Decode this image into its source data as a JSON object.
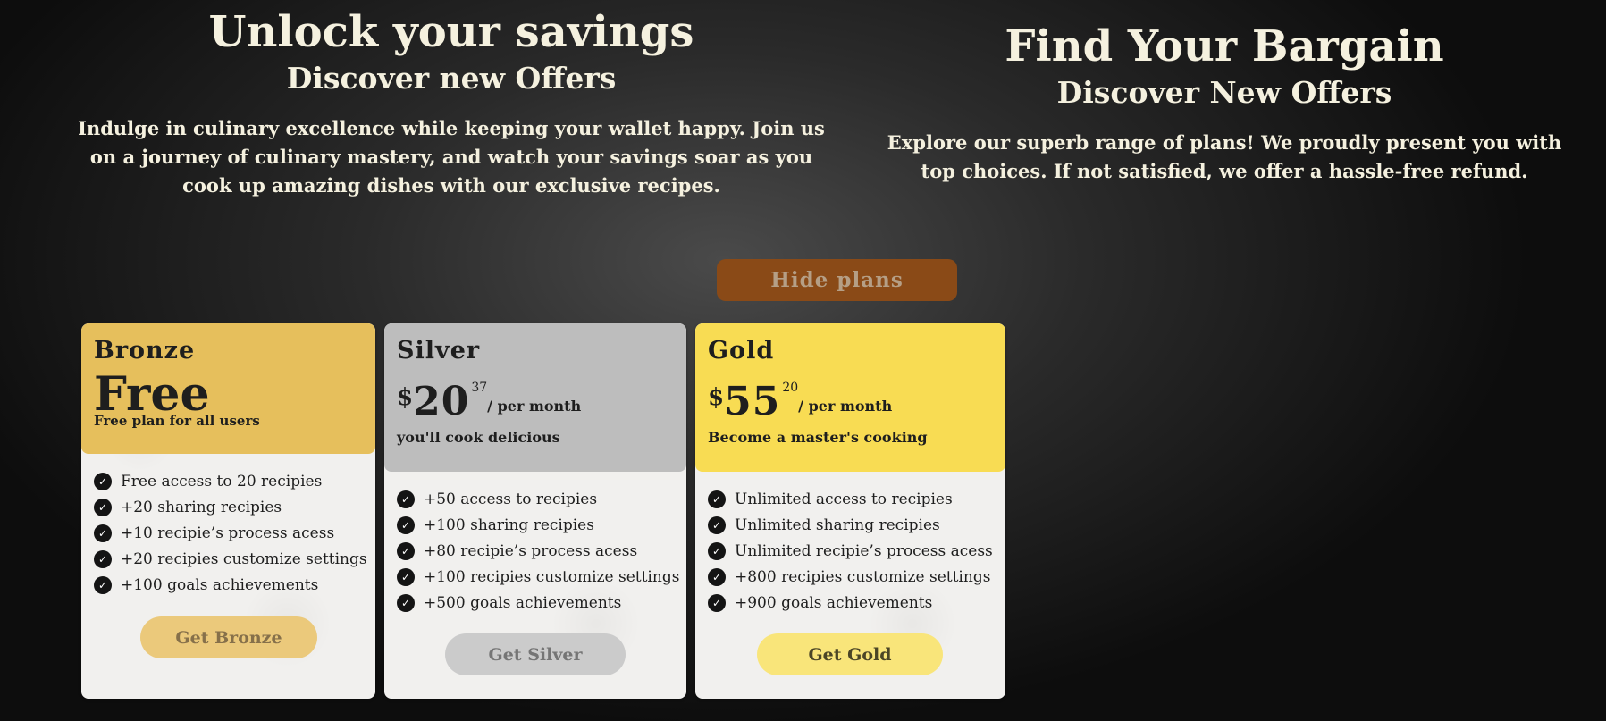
{
  "hero_left": {
    "title": "Unlock your savings",
    "subtitle": "Discover new Offers",
    "text": "Indulge in culinary excellence while keeping your wallet happy. Join us on a journey of culinary mastery, and watch your savings soar as you cook up amazing dishes with our exclusive recipes."
  },
  "hero_right": {
    "title": "Find Your Bargain",
    "subtitle": "Discover New Offers",
    "text": "Explore our superb range of plans! We proudly present you with top choices. If not satisfied, we offer a hassle-free refund."
  },
  "toggle_label": "Hide plans",
  "plans": [
    {
      "name": "Bronze",
      "price_text": "Free",
      "tagline": "Free plan for all users",
      "features": [
        "Free access to 20 recipies",
        "+20 sharing recipies",
        "+10 recipie’s process acess",
        "+20 recipies customize settings",
        "+100 goals achievements"
      ],
      "button": "Get Bronze",
      "color": "#e6bf5c"
    },
    {
      "name": "Silver",
      "currency": "$",
      "amount": "20",
      "cents": "37",
      "period": "/ per month",
      "tagline": "you'll cook delicious",
      "features": [
        "+50 access to recipies",
        "+100 sharing recipies",
        "+80 recipie’s process acess",
        "+100 recipies customize settings",
        "+500 goals achievements"
      ],
      "button": "Get Silver",
      "color": "#bdbdbd"
    },
    {
      "name": "Gold",
      "currency": "$",
      "amount": "55",
      "cents": "20",
      "period": "/ per month",
      "tagline": "Become a master's cooking",
      "features": [
        "Unlimited access to recipies",
        "Unlimited sharing recipies",
        "Unlimited recipie’s process acess",
        "+800 recipies customize settings",
        "+900 goals achievements"
      ],
      "button": "Get Gold",
      "color": "#f8dc53"
    }
  ],
  "icons": {
    "check": "check-circle-icon"
  },
  "colors": {
    "toggle_button": "#8a4a17",
    "text": "#f5f1df"
  }
}
